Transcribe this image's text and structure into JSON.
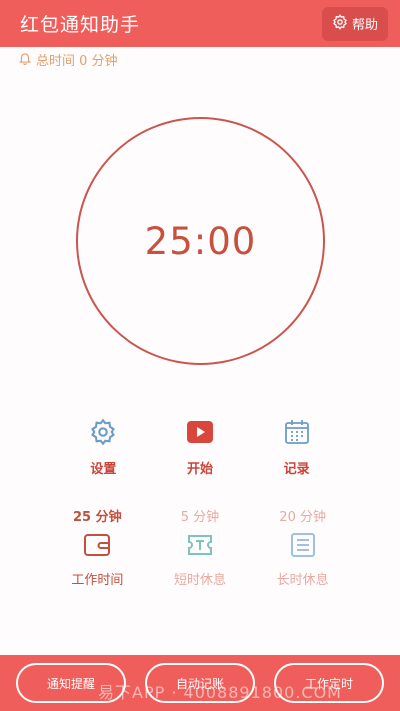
{
  "header": {
    "title": "红包通知助手",
    "help_label": "帮助",
    "help_icon": "gear-icon"
  },
  "total": {
    "icon": "bell-icon",
    "text": "总时间 0 分钟"
  },
  "timer": {
    "display": "25:00"
  },
  "actions": [
    {
      "icon": "gear-icon",
      "label": "设置"
    },
    {
      "icon": "play-icon",
      "label": "开始"
    },
    {
      "icon": "calendar-icon",
      "label": "记录"
    }
  ],
  "modes": [
    {
      "minutes": "25 分钟",
      "label": "工作时间",
      "icon": "wallet-icon",
      "active": true
    },
    {
      "minutes": "5 分钟",
      "label": "短时休息",
      "icon": "ticket-icon",
      "active": false
    },
    {
      "minutes": "20 分钟",
      "label": "长时休息",
      "icon": "list-icon",
      "active": false
    }
  ],
  "bottom": {
    "buttons": [
      "通知提醒",
      "自动记账",
      "工作定时"
    ],
    "watermark": "易下APP · 4008891800.COM"
  },
  "colors": {
    "primary": "#ef5e5a",
    "accent": "#c7503f",
    "muted": "#e8aaa1",
    "total_text": "#e4a06c"
  }
}
